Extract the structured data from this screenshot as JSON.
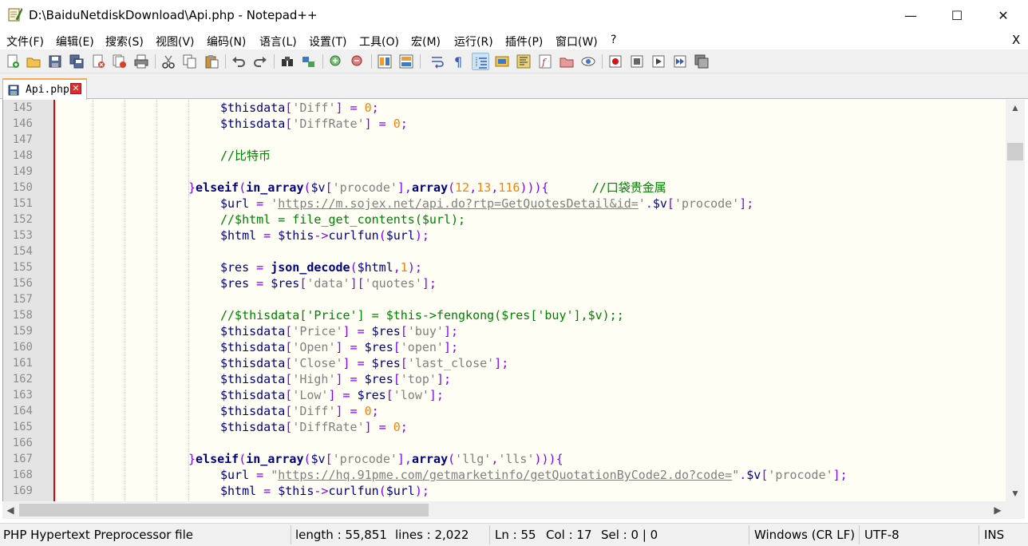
{
  "window": {
    "title": "D:\\BaiduNetdiskDownload\\Api.php - Notepad++",
    "minimize": "—",
    "maximize": "☐",
    "close": "✕"
  },
  "menu": {
    "items": [
      "文件(F)",
      "编辑(E)",
      "搜索(S)",
      "视图(V)",
      "编码(N)",
      "语言(L)",
      "设置(T)",
      "工具(O)",
      "宏(M)",
      "运行(R)",
      "插件(P)",
      "窗口(W)",
      "?"
    ],
    "close": "X"
  },
  "toolbar": {
    "icons": [
      "new-file-icon",
      "open-file-icon",
      "save-icon",
      "save-all-icon",
      "close-icon",
      "close-all-icon",
      "print-icon",
      "cut-icon",
      "copy-icon",
      "paste-icon",
      "undo-icon",
      "redo-icon",
      "find-icon",
      "replace-icon",
      "zoom-in-icon",
      "zoom-out-icon",
      "sync-vertical-icon",
      "sync-horizontal-icon",
      "word-wrap-icon",
      "show-all-chars-icon",
      "indent-guide-icon",
      "user-defined-lang-icon",
      "doc-map-icon",
      "function-list-icon",
      "folder-workspace-icon",
      "monitor-icon",
      "record-macro-icon",
      "stop-macro-icon",
      "play-macro-icon",
      "run-macro-multiple-icon",
      "save-macro-icon"
    ],
    "active": "indent-guide-icon"
  },
  "tabs": [
    {
      "label": "Api.php",
      "close": "✕"
    }
  ],
  "editor": {
    "lines": [
      {
        "no": "145",
        "tokens": [
          [
            "v",
            "$thisdata"
          ],
          [
            "o",
            "["
          ],
          [
            "s",
            "'Diff'"
          ],
          [
            "o",
            "] = "
          ],
          [
            "n",
            "0"
          ],
          [
            "o",
            ";"
          ]
        ],
        "indent": 5
      },
      {
        "no": "146",
        "tokens": [
          [
            "v",
            "$thisdata"
          ],
          [
            "o",
            "["
          ],
          [
            "s",
            "'DiffRate'"
          ],
          [
            "o",
            "] = "
          ],
          [
            "n",
            "0"
          ],
          [
            "o",
            ";"
          ]
        ],
        "indent": 5
      },
      {
        "no": "147",
        "tokens": [],
        "indent": 5
      },
      {
        "no": "148",
        "tokens": [
          [
            "c",
            "//比特币"
          ]
        ],
        "indent": 5
      },
      {
        "no": "149",
        "tokens": [],
        "indent": 5
      },
      {
        "no": "150",
        "tokens": [
          [
            "o",
            "}"
          ],
          [
            "k",
            "elseif"
          ],
          [
            "o",
            "("
          ],
          [
            "k",
            "in_array"
          ],
          [
            "o",
            "("
          ],
          [
            "v",
            "$v"
          ],
          [
            "o",
            "["
          ],
          [
            "s",
            "'procode'"
          ],
          [
            "o",
            "],"
          ],
          [
            "k",
            "array"
          ],
          [
            "o",
            "("
          ],
          [
            "n",
            "12"
          ],
          [
            "o",
            ","
          ],
          [
            "n",
            "13"
          ],
          [
            "o",
            ","
          ],
          [
            "n",
            "116"
          ],
          [
            "o",
            ")))"
          ],
          [
            "o",
            "{"
          ],
          [
            "o",
            "      "
          ],
          [
            "c",
            "//口袋贵金属"
          ]
        ],
        "indent": 4
      },
      {
        "no": "151",
        "tokens": [
          [
            "v",
            "$url"
          ],
          [
            "o",
            " = "
          ],
          [
            "s",
            "'"
          ],
          [
            "u",
            "https://m.sojex.net/api.do?rtp=GetQuotesDetail&id="
          ],
          [
            "s",
            "'"
          ],
          [
            "o",
            "."
          ],
          [
            "v",
            "$v"
          ],
          [
            "o",
            "["
          ],
          [
            "s",
            "'procode'"
          ],
          [
            "o",
            "];"
          ]
        ],
        "indent": 5
      },
      {
        "no": "152",
        "tokens": [
          [
            "c",
            "//$html = file_get_contents($url);"
          ]
        ],
        "indent": 5
      },
      {
        "no": "153",
        "tokens": [
          [
            "v",
            "$html"
          ],
          [
            "o",
            " = "
          ],
          [
            "v",
            "$this"
          ],
          [
            "o",
            "->"
          ],
          [
            "v",
            "curlfun"
          ],
          [
            "o",
            "("
          ],
          [
            "v",
            "$url"
          ],
          [
            "o",
            ");"
          ]
        ],
        "indent": 5
      },
      {
        "no": "154",
        "tokens": [],
        "indent": 5
      },
      {
        "no": "155",
        "tokens": [
          [
            "v",
            "$res"
          ],
          [
            "o",
            " = "
          ],
          [
            "k",
            "json_decode"
          ],
          [
            "o",
            "("
          ],
          [
            "v",
            "$html"
          ],
          [
            "o",
            ","
          ],
          [
            "n",
            "1"
          ],
          [
            "o",
            ");"
          ]
        ],
        "indent": 5
      },
      {
        "no": "156",
        "tokens": [
          [
            "v",
            "$res"
          ],
          [
            "o",
            " = "
          ],
          [
            "v",
            "$res"
          ],
          [
            "o",
            "["
          ],
          [
            "s",
            "'data'"
          ],
          [
            "o",
            "]["
          ],
          [
            "s",
            "'quotes'"
          ],
          [
            "o",
            "];"
          ]
        ],
        "indent": 5
      },
      {
        "no": "157",
        "tokens": [],
        "indent": 5
      },
      {
        "no": "158",
        "tokens": [
          [
            "c",
            "//$thisdata['Price'] = $this->fengkong($res['buy'],$v);;"
          ]
        ],
        "indent": 5
      },
      {
        "no": "159",
        "tokens": [
          [
            "v",
            "$thisdata"
          ],
          [
            "o",
            "["
          ],
          [
            "s",
            "'Price'"
          ],
          [
            "o",
            "] = "
          ],
          [
            "v",
            "$res"
          ],
          [
            "o",
            "["
          ],
          [
            "s",
            "'buy'"
          ],
          [
            "o",
            "];"
          ]
        ],
        "indent": 5
      },
      {
        "no": "160",
        "tokens": [
          [
            "v",
            "$thisdata"
          ],
          [
            "o",
            "["
          ],
          [
            "s",
            "'Open'"
          ],
          [
            "o",
            "] = "
          ],
          [
            "v",
            "$res"
          ],
          [
            "o",
            "["
          ],
          [
            "s",
            "'open'"
          ],
          [
            "o",
            "];"
          ]
        ],
        "indent": 5
      },
      {
        "no": "161",
        "tokens": [
          [
            "v",
            "$thisdata"
          ],
          [
            "o",
            "["
          ],
          [
            "s",
            "'Close'"
          ],
          [
            "o",
            "] = "
          ],
          [
            "v",
            "$res"
          ],
          [
            "o",
            "["
          ],
          [
            "s",
            "'last_close'"
          ],
          [
            "o",
            "];"
          ]
        ],
        "indent": 5
      },
      {
        "no": "162",
        "tokens": [
          [
            "v",
            "$thisdata"
          ],
          [
            "o",
            "["
          ],
          [
            "s",
            "'High'"
          ],
          [
            "o",
            "] = "
          ],
          [
            "v",
            "$res"
          ],
          [
            "o",
            "["
          ],
          [
            "s",
            "'top'"
          ],
          [
            "o",
            "];"
          ]
        ],
        "indent": 5
      },
      {
        "no": "163",
        "tokens": [
          [
            "v",
            "$thisdata"
          ],
          [
            "o",
            "["
          ],
          [
            "s",
            "'Low'"
          ],
          [
            "o",
            "] = "
          ],
          [
            "v",
            "$res"
          ],
          [
            "o",
            "["
          ],
          [
            "s",
            "'low'"
          ],
          [
            "o",
            "];"
          ]
        ],
        "indent": 5
      },
      {
        "no": "164",
        "tokens": [
          [
            "v",
            "$thisdata"
          ],
          [
            "o",
            "["
          ],
          [
            "s",
            "'Diff'"
          ],
          [
            "o",
            "] = "
          ],
          [
            "n",
            "0"
          ],
          [
            "o",
            ";"
          ]
        ],
        "indent": 5
      },
      {
        "no": "165",
        "tokens": [
          [
            "v",
            "$thisdata"
          ],
          [
            "o",
            "["
          ],
          [
            "s",
            "'DiffRate'"
          ],
          [
            "o",
            "] = "
          ],
          [
            "n",
            "0"
          ],
          [
            "o",
            ";"
          ]
        ],
        "indent": 5
      },
      {
        "no": "166",
        "tokens": [],
        "indent": 5
      },
      {
        "no": "167",
        "tokens": [
          [
            "o",
            "}"
          ],
          [
            "k",
            "elseif"
          ],
          [
            "o",
            "("
          ],
          [
            "k",
            "in_array"
          ],
          [
            "o",
            "("
          ],
          [
            "v",
            "$v"
          ],
          [
            "o",
            "["
          ],
          [
            "s",
            "'procode'"
          ],
          [
            "o",
            "],"
          ],
          [
            "k",
            "array"
          ],
          [
            "o",
            "("
          ],
          [
            "s",
            "'llg'"
          ],
          [
            "o",
            ","
          ],
          [
            "s",
            "'lls'"
          ],
          [
            "o",
            ")))"
          ],
          [
            "o",
            "{"
          ]
        ],
        "indent": 4
      },
      {
        "no": "168",
        "tokens": [
          [
            "v",
            "$url"
          ],
          [
            "o",
            " = "
          ],
          [
            "s",
            "\""
          ],
          [
            "u",
            "https://hq.91pme.com/getmarketinfo/getQuotationByCode2.do?code="
          ],
          [
            "s",
            "\""
          ],
          [
            "o",
            "."
          ],
          [
            "v",
            "$v"
          ],
          [
            "o",
            "["
          ],
          [
            "s",
            "'procode'"
          ],
          [
            "o",
            "];"
          ]
        ],
        "indent": 5
      },
      {
        "no": "169",
        "tokens": [
          [
            "v",
            "$html"
          ],
          [
            "o",
            " = "
          ],
          [
            "v",
            "$this"
          ],
          [
            "o",
            "->"
          ],
          [
            "v",
            "curlfun"
          ],
          [
            "o",
            "("
          ],
          [
            "v",
            "$url"
          ],
          [
            "o",
            ");"
          ]
        ],
        "indent": 5
      }
    ]
  },
  "scrollbars": {
    "up": "▲",
    "down": "▼",
    "left": "◀",
    "right": "▶"
  },
  "status": {
    "file_type": "PHP Hypertext Preprocessor file",
    "length": "length : 55,851",
    "lines": "lines : 2,022",
    "ln": "Ln : 55",
    "col": "Col : 17",
    "sel": "Sel : 0 | 0",
    "eol": "Windows (CR LF)",
    "encoding": "UTF-8",
    "mode": "INS"
  },
  "colors": {
    "fold_margin": "#e00000",
    "tab_accent": "#f9a75b",
    "comment": "#008000",
    "keyword": "#000080",
    "string": "#808080",
    "number": "#ff8000",
    "operator": "#8000ff"
  }
}
